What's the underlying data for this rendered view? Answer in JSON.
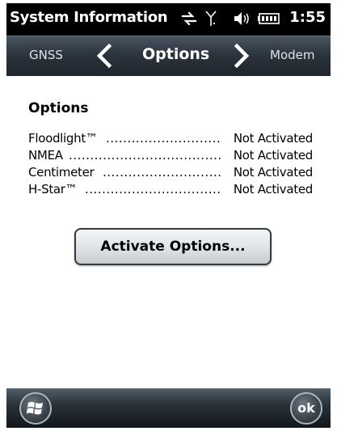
{
  "status_bar": {
    "title": "System Information",
    "time": "1:55",
    "icons": [
      "data-connection-icon",
      "signal-antenna-icon",
      "speaker-volume-icon",
      "battery-icon"
    ]
  },
  "nav": {
    "prev_label": "GNSS",
    "title": "Options",
    "next_label": "Modem"
  },
  "content": {
    "heading": "Options",
    "options": [
      {
        "name": "Floodlight™",
        "status": "Not Activated"
      },
      {
        "name": "NMEA",
        "status": "Not Activated"
      },
      {
        "name": "Centimeter",
        "status": "Not Activated"
      },
      {
        "name": "H-Star™",
        "status": "Not Activated"
      }
    ],
    "activate_label": "Activate Options..."
  },
  "bottom_bar": {
    "ok_label": "ok"
  },
  "colors": {
    "status_bar_bg": "#000000",
    "nav_bar_top": "#4a5561",
    "nav_bar_bottom": "#1e252c",
    "content_bg": "#ffffff",
    "text": "#000000"
  }
}
